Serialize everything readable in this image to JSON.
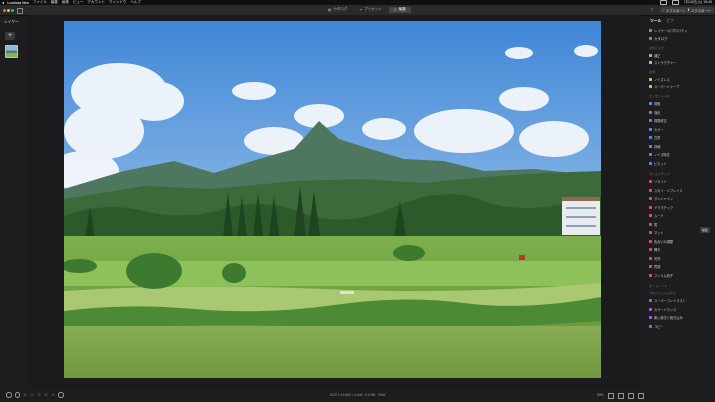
{
  "menubar": {
    "app_name": "Luminar Neo",
    "items": [
      "ファイル",
      "編集",
      "画像",
      "ビュー",
      "アカウント",
      "ウインドウ",
      "ヘルプ"
    ],
    "right_text": "7月16日(火) 18:45"
  },
  "toolbar": {
    "tabs": [
      {
        "label": "カタログ",
        "icon": "grid-icon",
        "active": false
      },
      {
        "label": "プリセット",
        "icon": "wand-icon",
        "active": false
      },
      {
        "label": "編集",
        "icon": "sliders-icon",
        "active": true
      }
    ],
    "share_label": "エクスポート",
    "export_label": "エクスポート"
  },
  "left_panel": {
    "title": "レイヤー",
    "add_label": "+"
  },
  "right_panel": {
    "tabs": [
      "ツール",
      "ビフ"
    ],
    "top_items": [
      {
        "label": "レイヤーのプロパティ",
        "icon": "layers-icon",
        "color": "#8a8a8a"
      },
      {
        "label": "カタログ",
        "icon": "catalog-icon",
        "color": "#8a8a8a"
      }
    ],
    "section_favorites": "お気に入り",
    "favorites": [
      {
        "label": "補正",
        "color": "#b0b0b0"
      },
      {
        "label": "ストラクチャー",
        "color": "#e4c13c"
      }
    ],
    "section_essentials": "必須",
    "essentials": [
      {
        "label": "ノイズレス",
        "color": "#e0c040"
      },
      {
        "label": "スーパーシャープ",
        "color": "#e0c040"
      }
    ],
    "section_basic": "エッセンシャル",
    "basic": [
      {
        "label": "現像",
        "color": "#4e8ef2"
      },
      {
        "label": "強化",
        "color": "#4e8ef2"
      },
      {
        "label": "構図修正",
        "color": "#4e8ef2"
      },
      {
        "label": "カラー",
        "color": "#4e8ef2"
      },
      {
        "label": "白黒",
        "color": "#4e8ef2"
      },
      {
        "label": "詳細",
        "color": "#4e8ef2"
      },
      {
        "label": "ノイズ除去",
        "color": "#4e8ef2"
      },
      {
        "label": "ビネット",
        "color": "#4e8ef2"
      }
    ],
    "section_creative": "クリエイティブ",
    "creative": [
      {
        "label": "リライト",
        "color": "#e34a6a"
      },
      {
        "label": "スカイ・リプレイス",
        "color": "#e34a6a"
      },
      {
        "label": "サンシャイン",
        "color": "#e34a6a"
      },
      {
        "label": "ドラマチック",
        "color": "#e34a6a"
      },
      {
        "label": "ムード",
        "color": "#e34a6a"
      },
      {
        "label": "霧",
        "color": "#e34a6a"
      },
      {
        "label": "マット",
        "color": "#e34a6a"
      },
      {
        "label": "色合いの調整",
        "color": "#e34a6a"
      },
      {
        "label": "輝き",
        "color": "#e34a6a"
      },
      {
        "label": "光沢",
        "color": "#e34a6a"
      },
      {
        "label": "質感",
        "color": "#e34a6a"
      },
      {
        "label": "フィルム粒子",
        "color": "#e34a6a"
      }
    ],
    "section_portrait": "ポートレート",
    "section_pro": "プロフェッショナル",
    "pro": [
      {
        "label": "スーパーコントラスト",
        "color": "#a15de8"
      },
      {
        "label": "カラーバランス",
        "color": "#a15de8"
      },
      {
        "label": "覆い焼きと焼き込み",
        "color": "#a15de8"
      },
      {
        "label": "コピー",
        "color": "#a15de8"
      }
    ],
    "edge_tab": "編集"
  },
  "bottom_bar": {
    "image_info": "2025.7.4 6,960 × 4,640 · 5.6 MB · RAW",
    "zoom": "50%"
  },
  "colors": {
    "accent_blue": "#4e8ef2",
    "accent_red": "#e34a6a",
    "accent_purple": "#a15de8",
    "accent_yellow": "#e0c040"
  }
}
